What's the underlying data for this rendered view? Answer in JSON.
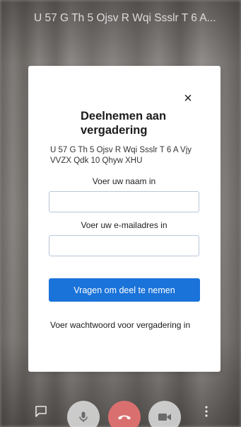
{
  "meeting": {
    "title": "U 57 G Th 5 Ojsv R Wqi Ssslr T 6 A..."
  },
  "dialog": {
    "title": "Deelnemen aan vergadering",
    "subtitle": "U 57 G Th 5 Ojsv R Wqi Ssslr T 6 A Vjy VVZX Qdk 10 Qhyw XHU",
    "close_symbol": "×",
    "name_label": "Voer uw naam in",
    "name_value": "",
    "email_label": "Voer uw e-mailadres in",
    "email_value": "",
    "join_button": "Vragen om deel te nemen",
    "password_link": "Voer wachtwoord voor vergadering in"
  },
  "toolbar": {
    "icons": [
      "chat-icon",
      "microphone-icon",
      "hang-up-icon",
      "camera-icon",
      "more-icon"
    ]
  },
  "colors": {
    "accent": "#1a73d9",
    "hangup": "#d9706f"
  }
}
